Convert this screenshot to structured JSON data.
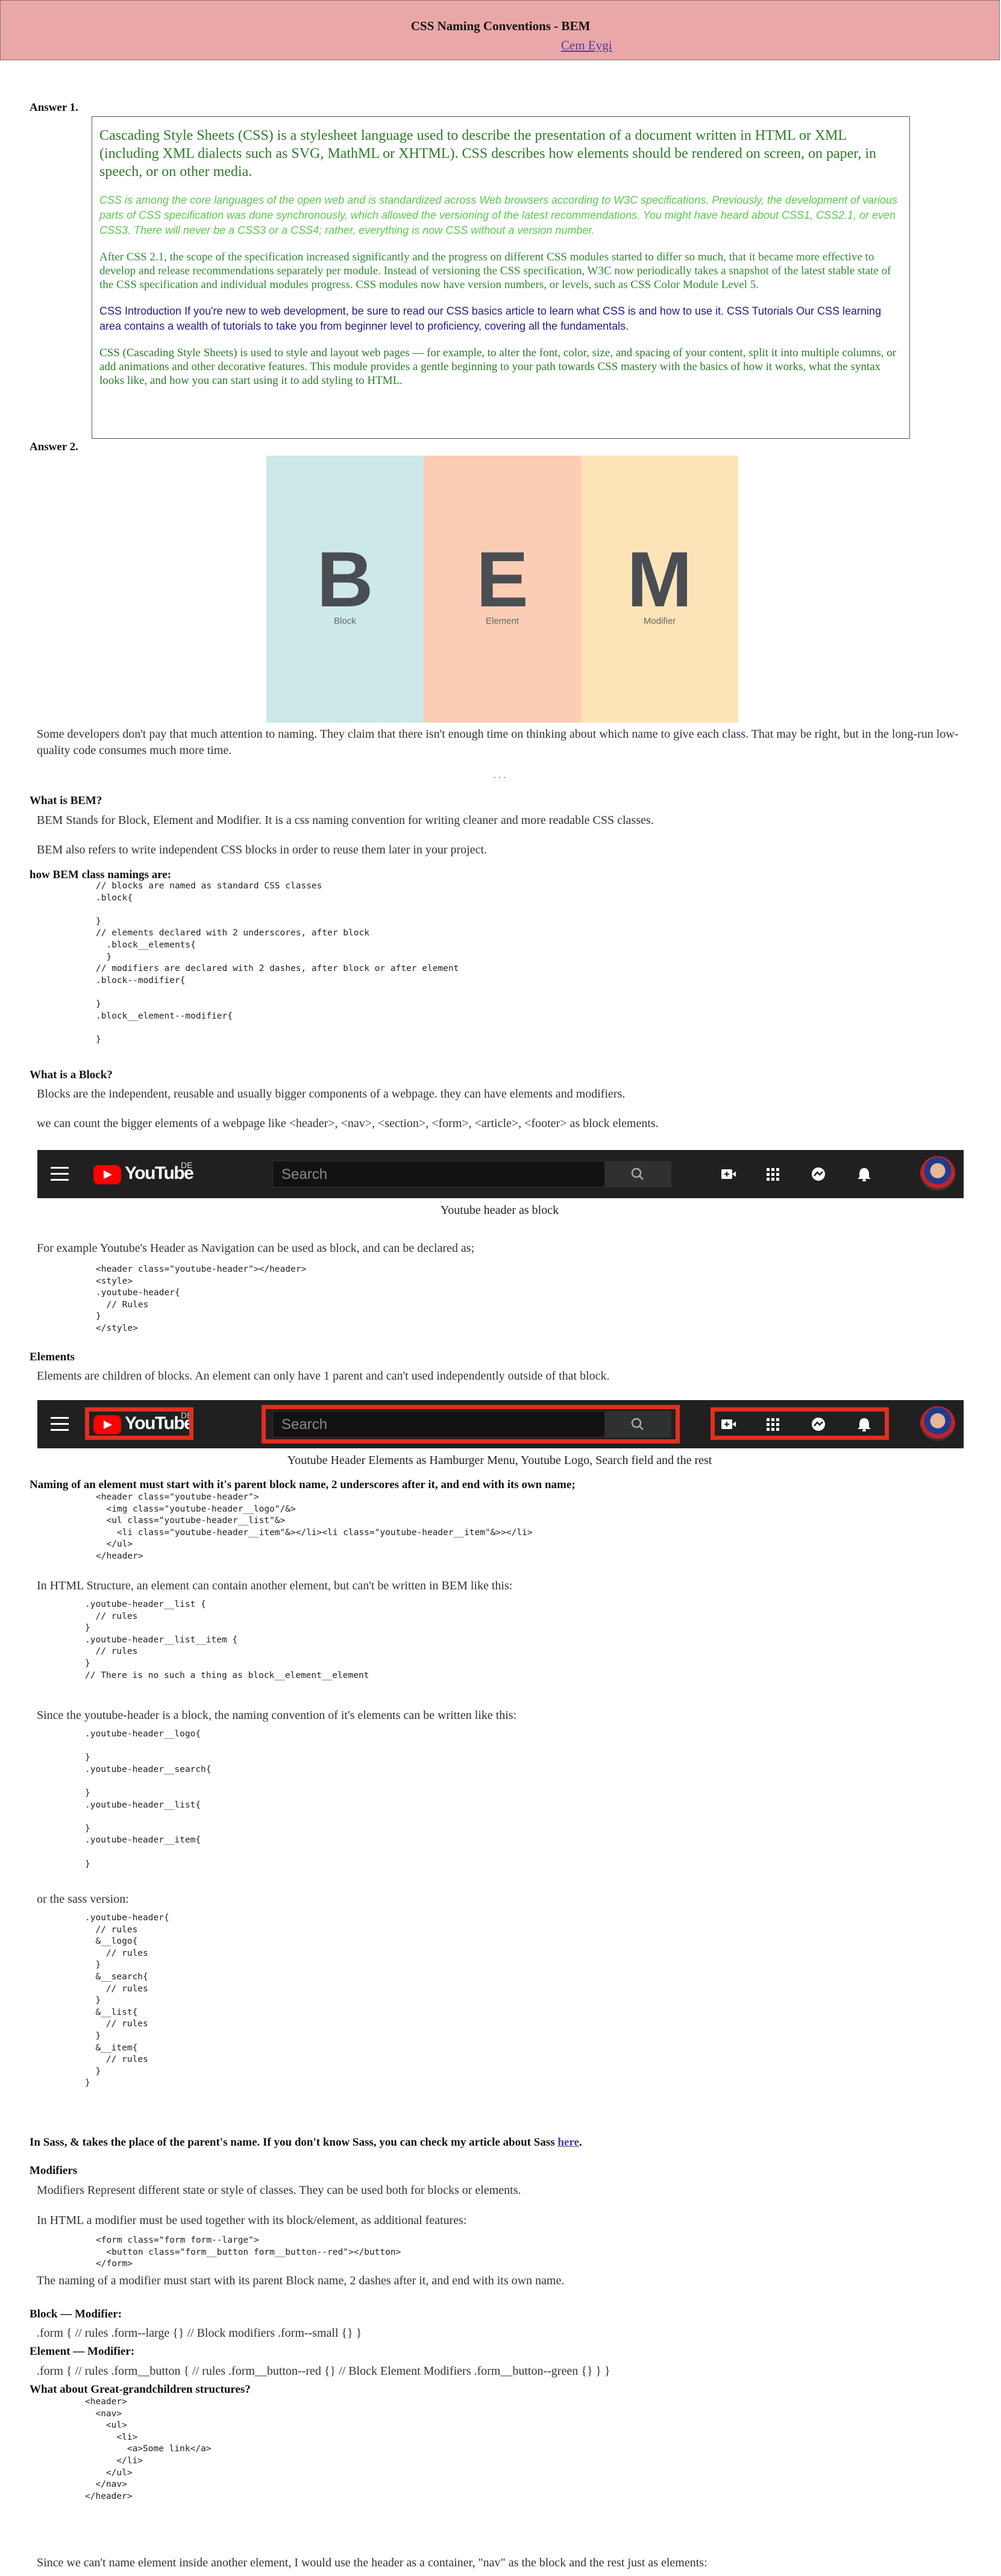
{
  "header": {
    "title": "CSS Naming Conventions - BEM",
    "author": "Cem Eygi"
  },
  "answer1": {
    "heading": "Answer 1.",
    "p1": "Cascading Style Sheets (CSS) is a stylesheet language used to describe the presentation of a document written in HTML or XML (including XML dialects such as SVG, MathML or XHTML). CSS describes how elements should be rendered on screen, on paper, in speech, or on other media.",
    "p2": "CSS is among the core languages of the open web and is standardized across Web browsers according to W3C specifications. Previously, the development of various parts of CSS specification was done synchronously, which allowed the versioning of the latest recommendations. You might have heard about CSS1, CSS2.1, or even CSS3. There will never be a CSS3 or a CSS4; rather, everything is now CSS without a version number.",
    "p3": "After CSS 2.1, the scope of the specification increased significantly and the progress on different CSS modules started to differ so much, that it became more effective to develop and release recommendations separately per module. Instead of versioning the CSS specification, W3C now periodically takes a snapshot of the latest stable state of the CSS specification and individual modules progress. CSS modules now have version numbers, or levels, such as CSS Color Module Level 5.",
    "p4": "CSS Introduction If you're new to web development, be sure to read our CSS basics article to learn what CSS is and how to use it. CSS Tutorials Our CSS learning area contains a wealth of tutorials to take you from beginner level to proficiency, covering all the fundamentals.",
    "p5": "CSS (Cascading Style Sheets) is used to style and layout web pages — for example, to alter the font, color, size, and spacing of your content, split it into multiple columns, or add animations and other decorative features. This module provides a gentle beginning to your path towards CSS mastery with the basics of how it works, what the syntax looks like, and how you can start using it to add styling to HTML."
  },
  "answer2": {
    "heading": "Answer 2.",
    "bem_image": {
      "columns": [
        {
          "letter": "B",
          "word": "Block",
          "color": "#cce8e8"
        },
        {
          "letter": "E",
          "word": "Element",
          "color": "#fbcdb5"
        },
        {
          "letter": "M",
          "word": "Modifier",
          "color": "#fde4b8"
        }
      ]
    },
    "intro": "Some developers don't pay that much attention to naming. They claim that there isn't enough time on thinking about which name to give each class. That may be right, but in the long-run low-quality code consumes much more time.",
    "separator": "· · ·"
  },
  "what_is_bem": {
    "heading": "What is BEM?",
    "p1": "BEM Stands for Block, Element and Modifier. It is a css naming convention for writing cleaner and more readable CSS classes.",
    "p2": "BEM also refers to write independent CSS blocks in order to reuse them later in your project."
  },
  "namings": {
    "heading": "how BEM class namings are:",
    "code": "// blocks are named as standard CSS classes\n.block{\n\n}\n// elements declared with 2 underscores, after block\n  .block__elements{\n  }\n// modifiers are declared with 2 dashes, after block or after element\n.block--modifier{\n\n}\n.block__element--modifier{\n\n}"
  },
  "block": {
    "heading": "What is a Block?",
    "p1": "Blocks are the independent, reusable and usually bigger components of a webpage. they can have elements and modifiers.",
    "p2": "we can count the bigger elements of a webpage like <header>, <nav>, <section>, <form>, <article>, <footer> as block elements.",
    "caption": "Youtube header as block",
    "p3": "For example Youtube's Header as Navigation can be used as block, and can be declared as;",
    "code": "<header class=\"youtube-header\"></header>\n<style>\n.youtube-header{\n  // Rules\n}\n</style>"
  },
  "youtube": {
    "logo": "YouTube",
    "region": "DE",
    "search_placeholder": "Search"
  },
  "elements": {
    "heading": "Elements",
    "p1": "Elements are children of blocks. An element can only have 1 parent and can't used independently outside of that block.",
    "caption": "Youtube Header Elements as Hamburger Menu, Youtube Logo, Search field and the rest",
    "naming_heading": "Naming of an element must start with it's parent block name, 2 underscores after it, and end with its own name;",
    "code1": "<header class=\"youtube-header\">\n  <img class=\"youtube-header__logo\"/&>\n  <ul class=\"youtube-header__list\"&>\n    <li class=\"youtube-header__item\"&></li><li class=\"youtube-header__item\"&>></li>\n  </ul>\n</header>",
    "p2": "In HTML Structure, an element can contain another element, but can't be written in BEM like this:",
    "code2": ".youtube-header__list {\n  // rules\n}\n.youtube-header__list__item {\n  // rules\n}\n// There is no such a thing as block__element__element",
    "p3": "Since the youtube-header is a block, the naming convention of it's elements can be written like this:",
    "code3": ".youtube-header__logo{\n\n}\n.youtube-header__search{\n\n}\n.youtube-header__list{\n\n}\n.youtube-header__item{\n\n}",
    "p4": "or the sass version:",
    "code4": ".youtube-header{\n  // rules\n  &__logo{\n    // rules\n  }\n  &__search{\n    // rules\n  }\n  &__list{\n    // rules\n  }\n  &__item{\n    // rules\n  }\n}",
    "sass_note": "In Sass, & takes the place of the parent's name. If you don't know Sass, you can check my article about Sass",
    "sass_link": "here",
    "sass_end": "."
  },
  "modifiers": {
    "heading": "Modifiers",
    "p1": "Modifiers Represent different state or style of classes. They can be used both for blocks or elements.",
    "p2": "In HTML a modifier must be used together with its block/element, as additional features:",
    "code": "<form class=\"form form--large\">\n  <button class=\"form__button form__button--red\"></button>\n</form>",
    "p3": "The naming of a modifier must start with its parent Block name, 2 dashes after it, and end with its own name.",
    "block_mod_heading": "Block — Modifier:",
    "block_mod_text": ".form { // rules .form--large {} // Block modifiers .form--small {} }",
    "elem_mod_heading": "Element — Modifier:",
    "elem_mod_text": ".form { // rules .form__button { // rules .form__button--red {} // Block Element Modifiers .form__button--green {} } }"
  },
  "greatgrand": {
    "heading": "What about Great-grandchildren structures?",
    "code": "<header>\n  <nav>\n    <ul>\n      <li>\n        <a>Some link</a>\n      </li>\n    </ul>\n  </nav>\n</header>",
    "p1": "Since we can't name element inside another element, I would use the header as a container, \"nav\" as the block and the rest just as elements:"
  }
}
